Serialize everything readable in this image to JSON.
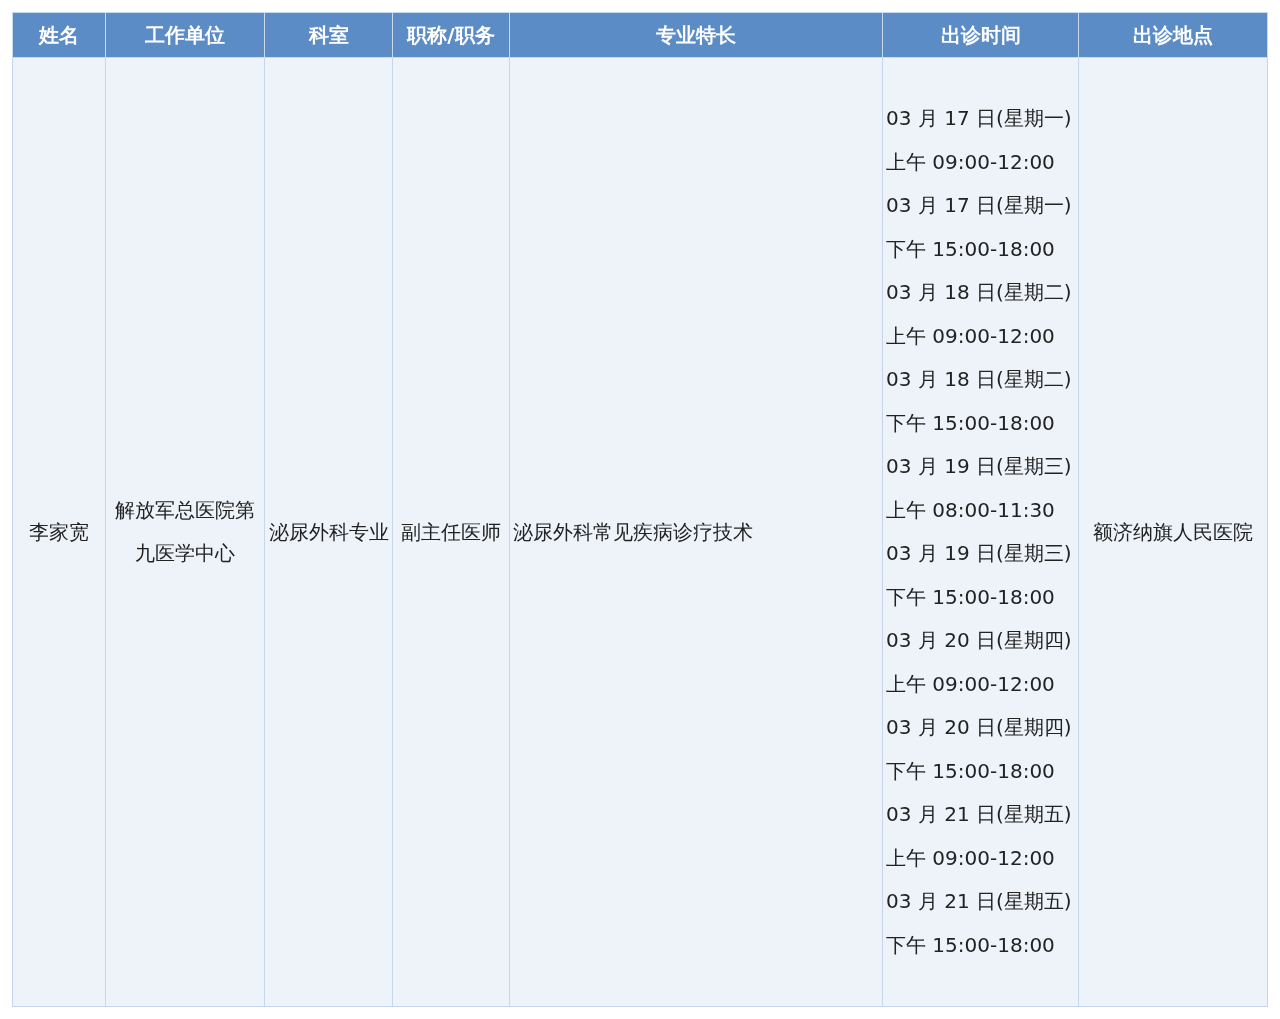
{
  "table": {
    "columns": [
      "姓名",
      "工作单位",
      "科室",
      "职称/职务",
      "专业特长",
      "出诊时间",
      "出诊地点"
    ],
    "rows": [
      {
        "name": "李家宽",
        "unit": "解放军总医院第九医学中心",
        "department": "泌尿外科专业",
        "title": "副主任医师",
        "specialty": "泌尿外科常见疾病诊疗技术",
        "schedule": [
          {
            "date": "03 月 17 日(星期一)",
            "time": "上午 09:00-12:00"
          },
          {
            "date": "03 月 17 日(星期一)",
            "time": "下午 15:00-18:00"
          },
          {
            "date": "03 月 18 日(星期二)",
            "time": "上午 09:00-12:00"
          },
          {
            "date": "03 月 18 日(星期二)",
            "time": "下午 15:00-18:00"
          },
          {
            "date": "03 月 19 日(星期三)",
            "time": "上午 08:00-11:30"
          },
          {
            "date": "03 月 19 日(星期三)",
            "time": "下午 15:00-18:00"
          },
          {
            "date": "03 月 20 日(星期四)",
            "time": "上午 09:00-12:00"
          },
          {
            "date": "03 月 20 日(星期四)",
            "time": "下午 15:00-18:00"
          },
          {
            "date": "03 月 21 日(星期五)",
            "time": "上午 09:00-12:00"
          },
          {
            "date": "03 月 21 日(星期五)",
            "time": "下午 15:00-18:00"
          }
        ],
        "location": "额济纳旗人民医院"
      }
    ]
  }
}
